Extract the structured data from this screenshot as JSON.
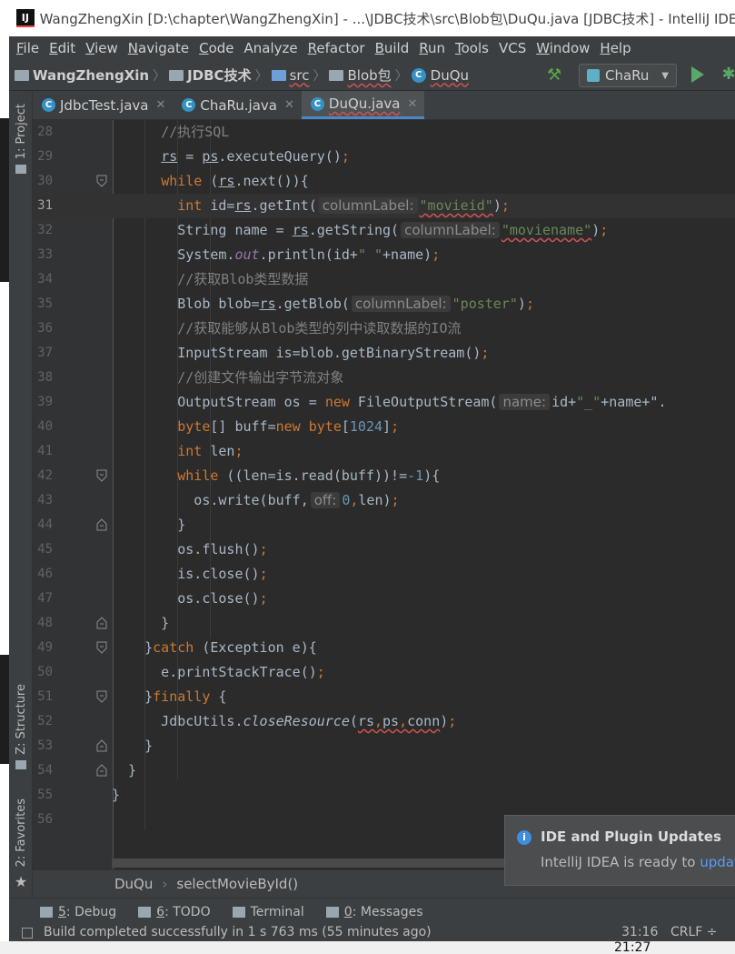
{
  "window": {
    "title": "WangZhengXin [D:\\chapter\\WangZhengXin] - ...\\JDBC技术\\src\\Blob包\\DuQu.java [JDBC技术] - IntelliJ IDEA",
    "app_icon": "IJ"
  },
  "menu": [
    {
      "u": "F",
      "rest": "ile"
    },
    {
      "u": "E",
      "rest": "dit"
    },
    {
      "u": "V",
      "rest": "iew"
    },
    {
      "u": "N",
      "rest": "avigate"
    },
    {
      "u": "C",
      "rest": "ode"
    },
    {
      "u": "",
      "rest": "Analyze"
    },
    {
      "u": "R",
      "rest": "efactor"
    },
    {
      "u": "B",
      "rest": "uild"
    },
    {
      "u": "R",
      "rest": "un"
    },
    {
      "u": "T",
      "rest": "ools"
    },
    {
      "u": "",
      "rest": "VCS"
    },
    {
      "u": "W",
      "rest": "indow"
    },
    {
      "u": "H",
      "rest": "elp"
    }
  ],
  "nav": {
    "project": "WangZhengXin",
    "module": "JDBC技术",
    "src": "src",
    "package": "Blob包",
    "file": "DuQu",
    "run_config": "ChaRu"
  },
  "tabs": [
    {
      "label": "JdbcTest.java",
      "active": false
    },
    {
      "label": "ChaRu.java",
      "active": false
    },
    {
      "label": "DuQu.java",
      "active": true
    }
  ],
  "side_tools": {
    "project": "1: Project",
    "structure": "Z: Structure",
    "favorites": "2: Favorites"
  },
  "editor": {
    "current_line": 31,
    "line_numbers": [
      "28",
      "29",
      "30",
      "31",
      "32",
      "33",
      "34",
      "35",
      "36",
      "37",
      "38",
      "39",
      "40",
      "41",
      "42",
      "43",
      "44",
      "45",
      "46",
      "47",
      "48",
      "49",
      "50",
      "51",
      "52",
      "53",
      "54",
      "55",
      "56"
    ],
    "comments": {
      "l28": "//执行SQL",
      "l34": "//获取Blob类型数据",
      "l36": "//获取能够从Blob类型的列中读取数据的IO流",
      "l38": "//创建文件输出字节流对象"
    },
    "hints": {
      "columnLabel": "columnLabel:",
      "name": "name:",
      "off": "off:"
    },
    "strings": {
      "movieid": "\"movieid\"",
      "moviename": "\"moviename\"",
      "space": "\" \"",
      "poster": "\"poster\"",
      "underscore": "\"_\""
    },
    "numbers": {
      "buf": "1024",
      "neg1": "-1",
      "zero": "0"
    }
  },
  "breadcrumb": {
    "class": "DuQu",
    "method": "selectMovieById()"
  },
  "notification": {
    "title": "IDE and Plugin Updates",
    "message": "IntelliJ IDEA is ready to ",
    "link": "update"
  },
  "bottom_tools": [
    {
      "key": "5",
      "label": ": Debug"
    },
    {
      "key": "6",
      "label": ": TODO"
    },
    {
      "key": "",
      "label": "Terminal"
    },
    {
      "key": "0",
      "label": ": Messages"
    }
  ],
  "status": {
    "message": "Build completed successfully in 1 s 763 ms (55 minutes ago)",
    "position": "31:16",
    "line_sep": "CRLF ÷"
  },
  "taskbar": {
    "clock": "21:27"
  }
}
